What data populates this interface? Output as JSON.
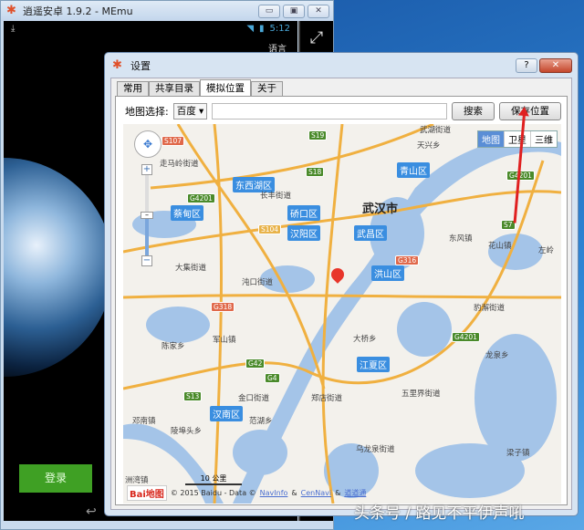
{
  "emulator": {
    "title": "逍遥安卓 1.9.2 - MEmu",
    "time": "5:12",
    "language": "语言",
    "login": "登录"
  },
  "dialog": {
    "title": "设置",
    "help": "?",
    "close": "✕",
    "tabs": [
      "常用",
      "共享目录",
      "模拟位置",
      "关于"
    ],
    "active_tab": "模拟位置",
    "map_select_label": "地图选择:",
    "map_provider": "百度",
    "search_value": "",
    "search_button": "搜索",
    "save_button": "保存位置"
  },
  "map": {
    "types": [
      "地图",
      "卫星",
      "三维"
    ],
    "active_type": "地图",
    "city": "武汉市",
    "districts": [
      "东西湖区",
      "硚口区",
      "汉阳区",
      "武昌区",
      "青山区",
      "洪山区",
      "蔡甸区",
      "江夏区",
      "汉南区"
    ],
    "towns": [
      "走马岭街道",
      "长丰街道",
      "天兴乡",
      "武湖街道",
      "东风镇",
      "花山镇",
      "左岭",
      "大集街道",
      "沌口街道",
      "豹澥街道",
      "军山镇",
      "陈家乡",
      "大桥乡",
      "龙泉乡",
      "金口街道",
      "郑店街道",
      "五里界街道",
      "范湖乡",
      "邓南镇",
      "陵埠头乡",
      "乌龙泉街道",
      "梁子镇",
      "洲湾镇"
    ],
    "shields": [
      "S19",
      "S18",
      "G4201",
      "G4201",
      "G4201",
      "S7",
      "S104",
      "G316",
      "G318",
      "G42",
      "G4",
      "S13",
      "S107"
    ],
    "scale": "10 公里",
    "logo": "Bai地图",
    "copyright": "© 2015 Baidu - Data ©",
    "link1": "NavInfo",
    "amp": "&",
    "link2": "CenNavi",
    "link3": "道道通"
  },
  "watermark": "头条号 / 路见不平伊声吼",
  "colors": {
    "water": "#a4c4e8",
    "road": "#f0b040",
    "land": "#f3f1ec",
    "district": "#3a8ee0"
  }
}
